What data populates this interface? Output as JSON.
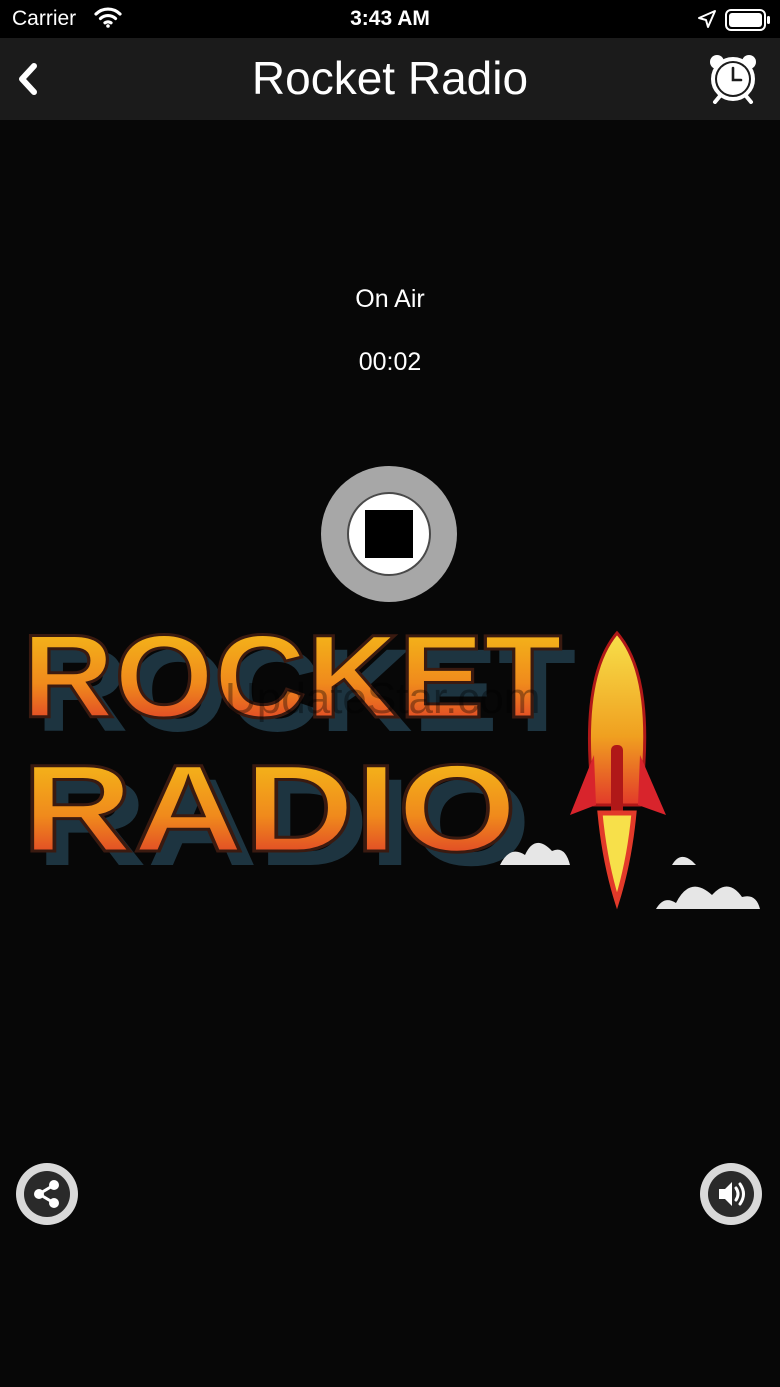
{
  "status_bar": {
    "carrier": "Carrier",
    "time": "3:43 AM",
    "icons": [
      "wifi-icon",
      "location-icon",
      "battery-icon"
    ]
  },
  "nav": {
    "title": "Rocket Radio",
    "back_icon": "chevron-left-icon",
    "alarm_icon": "alarm-clock-icon"
  },
  "player": {
    "status": "On Air",
    "elapsed": "00:02",
    "control_icon": "stop-icon"
  },
  "logo": {
    "line1": "ROCKET",
    "line2": "RADIO",
    "watermark": "UpdateStar.com"
  },
  "footer": {
    "left_icon": "share-icon",
    "right_icon": "volume-icon"
  },
  "colors": {
    "background": "#070707",
    "nav_background": "#1b1b1b",
    "button_gray": "#a7a7a7",
    "logo_yellow": "#f5c518",
    "logo_red": "#d8242c"
  }
}
